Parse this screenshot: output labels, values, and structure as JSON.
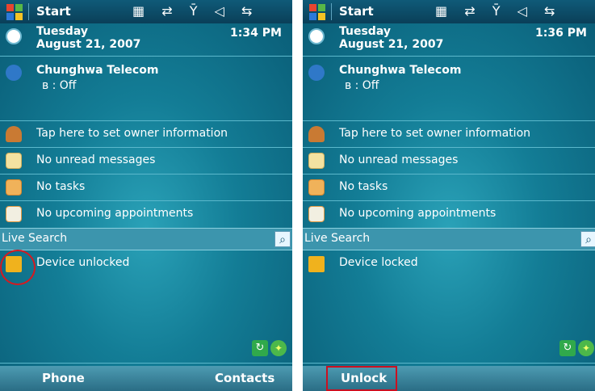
{
  "left": {
    "start_label": "Start",
    "status_icons": "▦ ⇄ Ȳ ◁ ⇆",
    "day": "Tuesday",
    "date": "August 21, 2007",
    "time": "1:34 PM",
    "carrier": "Chunghwa Telecom",
    "bluetooth": "ʙ : Off",
    "owner": "Tap here to set owner information",
    "messages": "No unread messages",
    "tasks": "No tasks",
    "appointments": "No upcoming appointments",
    "search_label": "Live Search",
    "search_glyph": "⌕",
    "device_status": "Device unlocked",
    "softkey_left": "Phone",
    "softkey_right": "Contacts"
  },
  "right": {
    "start_label": "Start",
    "status_icons": "▦ ⇄ Ȳ ◁ ⇆",
    "day": "Tuesday",
    "date": "August 21, 2007",
    "time": "1:36 PM",
    "carrier": "Chunghwa Telecom",
    "bluetooth": "ʙ : Off",
    "owner": "Tap here to set owner information",
    "messages": "No unread messages",
    "tasks": "No tasks",
    "appointments": "No upcoming appointments",
    "search_label": "Live Search",
    "search_glyph": "⌕",
    "device_status": "Device locked",
    "softkey_left": "Unlock"
  },
  "icons": {
    "clock": "clock-icon",
    "signal": "antenna-icon",
    "owner": "person-icon",
    "mail": "mail-icon",
    "tasks": "checkbox-icon",
    "calendar": "calendar-icon",
    "lock_open": "open-lock-icon",
    "lock_closed": "lock-icon",
    "sync": "sync-icon",
    "sphere": "sphere-icon"
  },
  "colors": {
    "title_bar": "#0a4e6a",
    "background": "#137d96",
    "accent_red": "#d71920"
  }
}
